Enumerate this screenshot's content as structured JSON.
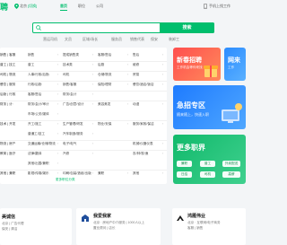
{
  "header": {
    "logo_text": "聘",
    "city": "北京",
    "switch_city": "[切换]",
    "nav": [
      "首页",
      "职位",
      "公司"
    ],
    "right_link": "手机上找工作",
    "brand_color": "#00be6d"
  },
  "search": {
    "placeholder": "",
    "button_label": "搜索",
    "hot_words": [
      "营运司机",
      "文员",
      "区域/场长",
      "服务员",
      "销售代表",
      "保安",
      "装卸工"
    ]
  },
  "categories": {
    "rows": [
      {
        "title": "销售 | 客服",
        "items": [
          "销售",
          "提成销售类",
          "客服/售后",
          "售后"
        ]
      },
      {
        "title": "普工 | 技工",
        "items": [
          "普工",
          "技术类",
          "后厨",
          "维修"
        ]
      },
      {
        "title": "司机 | 物流",
        "items": [
          "人事/行政/后勤",
          "司机",
          "仓储/物流",
          "贸易"
        ]
      },
      {
        "title": "餐饮 | 服务",
        "items": [
          "行政/后勤",
          "销售/客服",
          "保险/理财",
          "餐饮/酒店/饭店"
        ]
      },
      {
        "title": "后勤 | 行政",
        "items": [
          "客服/售后",
          "财务/会计",
          "",
          ""
        ]
      },
      {
        "title": "财务 | 计",
        "items": [
          "财务/会计/审计",
          "广告/创意/设计",
          "美容美发",
          "动漫"
        ]
      },
      {
        "title": "",
        "items": [
          "市场/公关/媒体",
          "",
          "",
          ""
        ]
      },
      {
        "title": "技术 | 开发",
        "items": [
          "开工/施工",
          "生产管理/研发",
          "物业/安保",
          "服务/家政/保洁"
        ]
      },
      {
        "title": "",
        "items": [
          "普通工/技工",
          "汽车制造/服务",
          "",
          ""
        ]
      },
      {
        "title": "物流 | 房产",
        "items": [
          "交通运输/仓储/物流",
          "电子/电气",
          "",
          "机械/仪器仪表"
        ]
      },
      {
        "title": "教育 | 医疗",
        "items": [
          "法律/翻译",
          "汽修",
          "",
          "农/林/牧/渔"
        ]
      },
      {
        "title": "",
        "items": [
          "其他/出国/兼职",
          "",
          "",
          ""
        ]
      },
      {
        "title": "其他 | 兼职",
        "items": [
          "影视/传媒/娱乐",
          "印刷/包装/造纸/出版",
          "兼职",
          "其他"
        ]
      }
    ],
    "more_link": "更多职位分类"
  },
  "promos": {
    "banner1_title": "新春招聘",
    "banner1_sub": "工作机会等你来找",
    "banner2_title": "网来",
    "banner2_sub": "工作",
    "banner3_title": "急招专区",
    "banner3_sub": "随来随上，快速入职",
    "banner4_title": "更多职界",
    "banner4_chips": [
      "兼职",
      "普工",
      "外卖配送",
      "日结",
      "司机",
      "高薪"
    ]
  },
  "companies": [
    {
      "name": "美诚信",
      "meta": "北京 | 广告代理",
      "tag": "保安 | 清洁"
    },
    {
      "name": "我爱我家",
      "meta": "北京 · 房地产中介服务 | 1000人以上",
      "tag": "置业顾问 | 店长"
    },
    {
      "name": "鸿雁伟业",
      "meta": "北京 · 互联网/电子商务",
      "tag": "客服 | 销售"
    }
  ]
}
